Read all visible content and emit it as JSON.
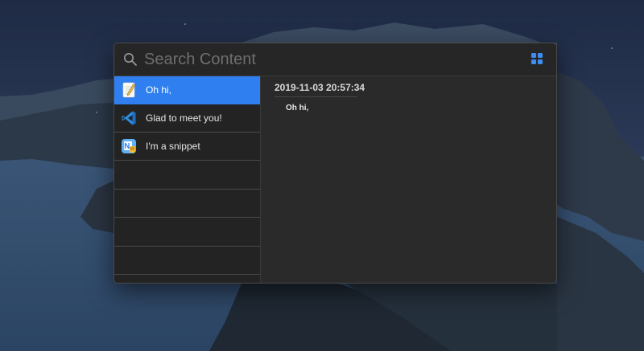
{
  "search": {
    "placeholder": "Search Content",
    "value": ""
  },
  "icons": {
    "search": "search-icon",
    "view_toggle": "grid-icon"
  },
  "colors": {
    "selection": "#2f7ff0",
    "panel_bg": "#262626",
    "grid_icon": "#3d8df5"
  },
  "snippets": [
    {
      "label": "Oh hi,",
      "icon": "textedit-icon",
      "selected": true
    },
    {
      "label": "Glad to meet you!",
      "icon": "vscode-icon",
      "selected": false
    },
    {
      "label": "I'm a snippet",
      "icon": "app-icon",
      "selected": false
    }
  ],
  "preview": {
    "date": "2019-11-03 20:57:34",
    "content": "Oh hi,"
  }
}
